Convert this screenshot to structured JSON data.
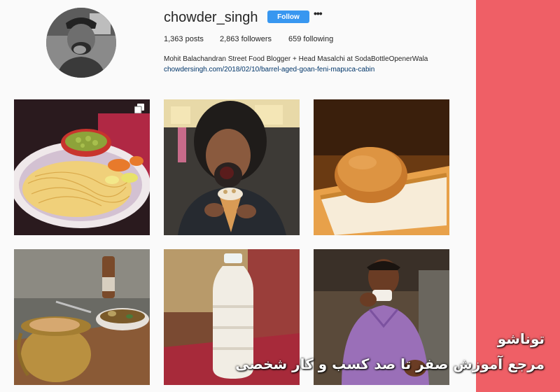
{
  "profile": {
    "username": "chowder_singh",
    "follow_label": "Follow",
    "more_label": "•••",
    "stats": {
      "posts": "1,363 posts",
      "followers": "2,863 followers",
      "following": "659 following"
    },
    "bio": "Mohit Balachandran Street Food Blogger + Head Masalchi at SodaBottleOpenerWala",
    "link": "chowdersingh.com/2018/02/10/barrel-aged-goan-feni-mapuca-cabin"
  },
  "colors": {
    "accent": "#3897f0",
    "side_band": "#ef5f66",
    "link": "#003569"
  },
  "watermark": {
    "line1": "توناشو",
    "line2": "مرجع آموزش صفر تا صد کسب و کار شخصی"
  },
  "posts": [
    {
      "subject": "noodles-plate",
      "multi": true
    },
    {
      "subject": "man-eating-cone",
      "multi": false
    },
    {
      "subject": "bun-on-tray",
      "multi": false
    },
    {
      "subject": "pot-and-bowl",
      "multi": false
    },
    {
      "subject": "milk-bottle",
      "multi": false
    },
    {
      "subject": "man-drinking",
      "multi": false
    }
  ]
}
